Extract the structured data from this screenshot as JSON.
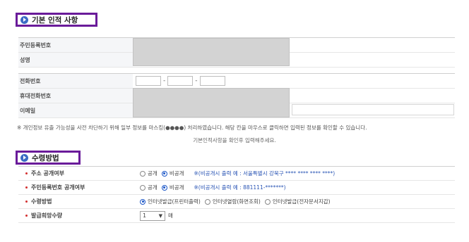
{
  "section1": {
    "title": "기본 인적 사항",
    "rows": [
      {
        "label": "주민등록번호"
      },
      {
        "label": "성명"
      },
      {
        "label": "전화번호",
        "dash1": "-",
        "dash2": "-"
      },
      {
        "label": "휴대전화번호"
      },
      {
        "label": "이메일"
      }
    ],
    "notice": "※ 개인정보 유출 가능성을 사전 차단하기 위해 일부 정보를 마스킹(●●●●) 처리하였습니다. 해당 칸을 마우스로 클릭하면 입력된 정보를 확인할 수 있습니다.",
    "sub_notice": "기본인적사항을 확인후 입력해주세요."
  },
  "section2": {
    "title": "수령방법",
    "rows": [
      {
        "label": "주소 공개여부",
        "options": [
          {
            "label": "공개",
            "checked": false
          },
          {
            "label": "비공개",
            "checked": true
          }
        ],
        "hint": "※(비공개시 출력 예 : 서울특별시 강북구 **** **** **** ****)"
      },
      {
        "label": "주민등록번호 공개여부",
        "options": [
          {
            "label": "공개",
            "checked": false
          },
          {
            "label": "비공개",
            "checked": true
          }
        ],
        "hint": "※(비공개시 출력 예 : 881111-*******)"
      },
      {
        "label": "수령방법",
        "options": [
          {
            "label": "인터넷발급(프린터출력)",
            "checked": true
          },
          {
            "label": "인터넷열람(화면조회)",
            "checked": false
          },
          {
            "label": "인터넷발급(전자문서지갑)",
            "checked": false
          }
        ]
      },
      {
        "label": "발급희망수량",
        "select_value": "1",
        "unit": "매"
      }
    ]
  },
  "colors": {
    "accent_border": "#6a1b9a",
    "bullet": "#3b6bc4",
    "hint_text": "#2b56b5",
    "required_dot": "#d32f2f"
  },
  "icons": {
    "section_bullet": "play-circle-icon",
    "select_chevron": "chevron-down-icon"
  }
}
